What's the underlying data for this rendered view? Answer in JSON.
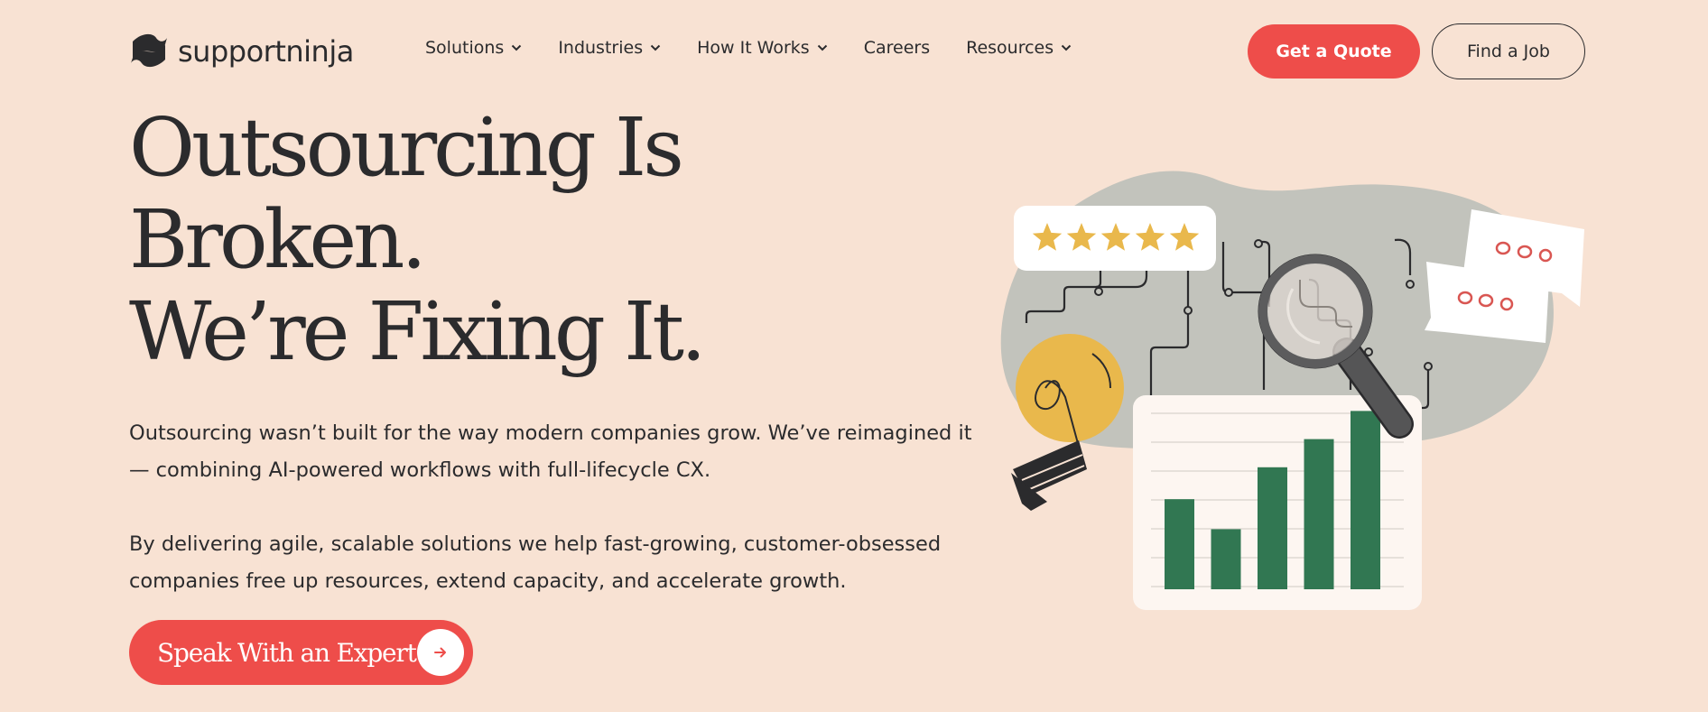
{
  "brand": {
    "name": "supportninja",
    "logo_icon": "ninja-logo-icon"
  },
  "nav": {
    "items": [
      {
        "label": "Solutions",
        "has_dropdown": true
      },
      {
        "label": "Industries",
        "has_dropdown": true
      },
      {
        "label": "How It Works",
        "has_dropdown": true
      },
      {
        "label": "Careers",
        "has_dropdown": false
      },
      {
        "label": "Resources",
        "has_dropdown": true
      }
    ],
    "quote_button": "Get a Quote",
    "job_button": "Find a Job"
  },
  "hero": {
    "headline_lines": [
      "Outsourcing Is",
      "Broken.",
      "We’re Fixing It."
    ],
    "paragraph_1": "Outsourcing wasn’t built for the way modern companies grow. We’ve reimagined it — combining AI-powered workflows with full-lifecycle CX.",
    "paragraph_2": "By delivering agile, scalable solutions we help fast-growing, customer-obsessed companies free up resources, extend capacity, and accelerate growth.",
    "cta_label": "Speak With an Expert",
    "cta_icon": "arrow-right-icon"
  },
  "illustration": {
    "rating_stars": 5,
    "bar_values": [
      0.48,
      0.32,
      0.65,
      0.8,
      0.95
    ],
    "icons": [
      "star-icon",
      "lightbulb-icon",
      "magnifier-icon",
      "chat-bubble-icon",
      "bar-chart-icon"
    ]
  },
  "colors": {
    "background": "#f8e2d3",
    "accent": "#ee4d4a",
    "text": "#2b2b2d",
    "chart_green": "#317752",
    "star_gold": "#e9b84c"
  }
}
